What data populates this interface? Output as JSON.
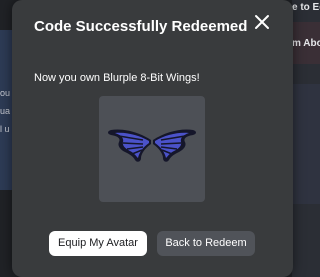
{
  "modal": {
    "title": "Code Successfully Redeemed",
    "message": "Now you own Blurple 8-Bit Wings!",
    "item_image_alt": "Blurple 8-Bit Wings",
    "buttons": {
      "equip_label": "Equip My Avatar",
      "back_label": "Back to Redeem"
    }
  },
  "icons": {
    "close": "close-icon",
    "item": "wings-icon"
  },
  "colors": {
    "modal_bg": "#393b3d",
    "thumbnail_bg": "#4d5056",
    "wing_feather": "#4b52c9",
    "wing_dark": "#15162a",
    "primary_button_bg": "#ffffff",
    "secondary_button_bg": "#505359"
  },
  "background_page": {
    "right_partial_text_1": "e to Ed",
    "right_partial_text_2": "m Abo",
    "left_partial_text_1": "ou",
    "left_partial_text_2": "ua",
    "left_partial_text_3": "l u"
  }
}
